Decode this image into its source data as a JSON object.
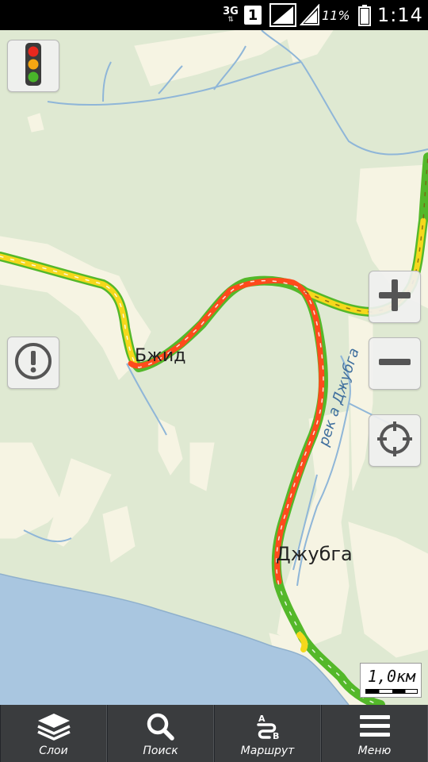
{
  "status_bar": {
    "network": "3G",
    "sim": "1",
    "battery_percent": "11%",
    "time": "1:14"
  },
  "map": {
    "labels": {
      "village_bzhid": "Бжид",
      "town_dzhubga": "Джубга",
      "river": "рек а Джубга"
    },
    "scale_label": "1,0км",
    "colors": {
      "land": "#dfe9d2",
      "sea": "#a9c6e0",
      "river": "#8fb6d8",
      "sand": "#f6f4e3",
      "traffic_red": "#ff4a1c",
      "traffic_yellow": "#f5d81c",
      "traffic_green": "#54b82a"
    },
    "controls": {
      "traffic": "traffic-light-icon",
      "alert": "exclamation-icon",
      "zoom_in": "plus-icon",
      "zoom_out": "minus-icon",
      "locate": "crosshair-icon"
    }
  },
  "bottom_nav": {
    "items": [
      {
        "label": "Слои",
        "icon": "layers-icon"
      },
      {
        "label": "Поиск",
        "icon": "search-icon"
      },
      {
        "label": "Маршрут",
        "icon": "route-icon"
      },
      {
        "label": "Меню",
        "icon": "menu-icon"
      }
    ]
  }
}
